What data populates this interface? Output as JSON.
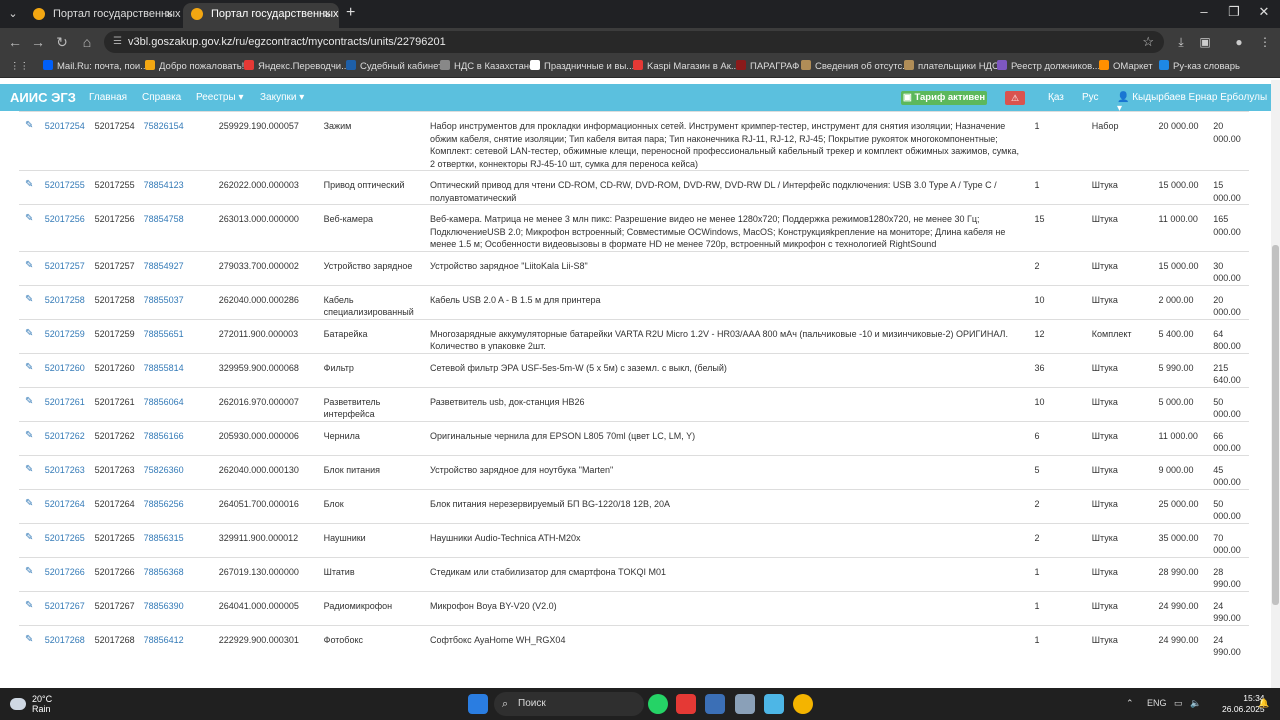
{
  "browser": {
    "tabs": [
      {
        "title": "Портал государственных закуп",
        "active": false
      },
      {
        "title": "Портал государственных закуп",
        "active": true
      }
    ],
    "url": "v3bl.goszakup.gov.kz/ru/egzcontract/mycontracts/units/22796201",
    "bookmarks": [
      {
        "label": "Mail.Ru: почта, пои...",
        "color": "#005ff9"
      },
      {
        "label": "Добро пожаловать!",
        "color": "#f3a712"
      },
      {
        "label": "Яндекс.Переводчи...",
        "color": "#e53935"
      },
      {
        "label": "Судебный кабинет",
        "color": "#1e5fa8"
      },
      {
        "label": "НДС в Казахстане",
        "color": "#888888"
      },
      {
        "label": "Праздничные и вы...",
        "color": "#ffffff"
      },
      {
        "label": "Kaspi Магазин в Ак...",
        "color": "#e53935"
      },
      {
        "label": "ПАРАГРАФ",
        "color": "#8b1a1a"
      },
      {
        "label": "Сведения об отсутс...",
        "color": "#b08d57"
      },
      {
        "label": "плательщики НДС",
        "color": "#b08d57"
      },
      {
        "label": "Реестр должников...",
        "color": "#7e57c2"
      },
      {
        "label": "ОМаркет",
        "color": "#ff8f00"
      },
      {
        "label": "Ру-каз словарь",
        "color": "#1e88e5"
      }
    ]
  },
  "app": {
    "brand": "АИИС ЭГЗ",
    "nav": [
      "Главная",
      "Справка",
      "Реестры ▾",
      "Закупки ▾"
    ],
    "tariff": "Тариф активен",
    "lang_kaz": "Қаз",
    "lang_rus": "Рус",
    "user": "Кыдырбаев Ернар Ерболулы ▾",
    "accent": "#5bc0de"
  },
  "rows": [
    {
      "id": "52017254",
      "num": "52017254",
      "lot": "75826154",
      "code": "259929.190.000057",
      "name": "Зажим",
      "desc": "Набор инструментов для прокладки информационных сетей. Инструмент кримпер-тестер, инструмент для снятия изоляции; Назначение обжим кабеля, снятие изоляции; Тип кабеля витая пара; Тип наконечника RJ-11, RJ-12, RJ-45; Покрытие рукояток многокомпонентные; Комплект: сетевой LAN-тестер, обжимные клещи, переносной профессиональный кабельный трекер и комплект обжимных зажимов, сумка, 2 отвертки, коннекторы RJ-45-10 шт, сумка для переноса кейса)",
      "qty": "1",
      "unit": "Набор",
      "price": "20 000.00",
      "sum": "20 000.00"
    },
    {
      "id": "52017255",
      "num": "52017255",
      "lot": "78854123",
      "code": "262022.000.000003",
      "name": "Привод оптический",
      "desc": "Оптический привод для чтени CD-ROM, CD-RW, DVD-ROM, DVD-RW, DVD-RW DL / Интерфейс подключения: USB 3.0 Type A / Type C / полуавтоматический",
      "qty": "1",
      "unit": "Штука",
      "price": "15 000.00",
      "sum": "15 000.00"
    },
    {
      "id": "52017256",
      "num": "52017256",
      "lot": "78854758",
      "code": "263013.000.000000",
      "name": "Веб-камера",
      "desc": "Веб-камера. Матрица не менее 3 млн пикс: Разрешение видео не менее 1280х720; Поддержка режимов1280х720, не менее 30 Гц; ПодключениеUSB 2.0; Микрофон встроенный; Совместимые OCWindows, MacOS; Конструкцияkрепление на мониторе; Длина кабеля не менее 1.5 м; Особенности видеовызовы в формате HD не менее 720p, встроенный микрофон с технологией RightSound",
      "qty": "15",
      "unit": "Штука",
      "price": "11 000.00",
      "sum": "165 000.00"
    },
    {
      "id": "52017257",
      "num": "52017257",
      "lot": "78854927",
      "code": "279033.700.000002",
      "name": "Устройство зарядное",
      "desc": "Устройство зарядное \"LiitoKala Lii-S8\"",
      "qty": "2",
      "unit": "Штука",
      "price": "15 000.00",
      "sum": "30 000.00"
    },
    {
      "id": "52017258",
      "num": "52017258",
      "lot": "78855037",
      "code": "262040.000.000286",
      "name": "Кабель специализированный",
      "desc": "Кабель USB 2.0 A - B 1.5 м для принтера",
      "qty": "10",
      "unit": "Штука",
      "price": "2 000.00",
      "sum": "20 000.00"
    },
    {
      "id": "52017259",
      "num": "52017259",
      "lot": "78855651",
      "code": "272011.900.000003",
      "name": "Батарейка",
      "desc": "Многозарядные аккумуляторные батарейки VARTA R2U Micro 1.2V - HR03/AAA 800 мАч (пальчиковые -10 и мизинчиковые-2) ОРИГИНАЛ. Количество в упаковке 2шт.",
      "qty": "12",
      "unit": "Комплект",
      "price": "5 400.00",
      "sum": "64 800.00"
    },
    {
      "id": "52017260",
      "num": "52017260",
      "lot": "78855814",
      "code": "329959.900.000068",
      "name": "Фильтр",
      "desc": "Сетевой фильтр ЭРА USF-5es-5m-W (5 х 5м) с заземл. с выкл, (белый)",
      "qty": "36",
      "unit": "Штука",
      "price": "5 990.00",
      "sum": "215 640.00"
    },
    {
      "id": "52017261",
      "num": "52017261",
      "lot": "78856064",
      "code": "262016.970.000007",
      "name": "Разветвитель интерфейса",
      "desc": "Разветвитель usb, док-станция HB26",
      "qty": "10",
      "unit": "Штука",
      "price": "5 000.00",
      "sum": "50 000.00"
    },
    {
      "id": "52017262",
      "num": "52017262",
      "lot": "78856166",
      "code": "205930.000.000006",
      "name": "Чернила",
      "desc": "Оригинальные чернила для EPSON L805 70ml (цвет LC, LM, Y)",
      "qty": "6",
      "unit": "Штука",
      "price": "11 000.00",
      "sum": "66 000.00"
    },
    {
      "id": "52017263",
      "num": "52017263",
      "lot": "75826360",
      "code": "262040.000.000130",
      "name": "Блок питания",
      "desc": "Устройство зарядное для ноутбука \"Marten\"",
      "qty": "5",
      "unit": "Штука",
      "price": "9 000.00",
      "sum": "45 000.00"
    },
    {
      "id": "52017264",
      "num": "52017264",
      "lot": "78856256",
      "code": "264051.700.000016",
      "name": "Блок",
      "desc": "Блок питания нерезервируемый БП BG-1220/18 12В, 20А",
      "qty": "2",
      "unit": "Штука",
      "price": "25 000.00",
      "sum": "50 000.00"
    },
    {
      "id": "52017265",
      "num": "52017265",
      "lot": "78856315",
      "code": "329911.900.000012",
      "name": "Наушники",
      "desc": "Наушники Audio-Technica ATH-M20x",
      "qty": "2",
      "unit": "Штука",
      "price": "35 000.00",
      "sum": "70 000.00"
    },
    {
      "id": "52017266",
      "num": "52017266",
      "lot": "78856368",
      "code": "267019.130.000000",
      "name": "Штатив",
      "desc": "Стедикам или стабилизатор для смартфона TOKQI M01",
      "qty": "1",
      "unit": "Штука",
      "price": "28 990.00",
      "sum": "28 990.00"
    },
    {
      "id": "52017267",
      "num": "52017267",
      "lot": "78856390",
      "code": "264041.000.000005",
      "name": "Радиомикрофон",
      "desc": "Микрофон Boya BY-V20 (V2.0)",
      "qty": "1",
      "unit": "Штука",
      "price": "24 990.00",
      "sum": "24 990.00"
    },
    {
      "id": "52017268",
      "num": "52017268",
      "lot": "78856412",
      "code": "222929.900.000301",
      "name": "Фотобокс",
      "desc": "Софтбокс AyaHome WH_RGX04",
      "qty": "1",
      "unit": "Штука",
      "price": "24 990.00",
      "sum": "24 990.00"
    }
  ],
  "taskbar": {
    "weather_temp": "20°C",
    "weather_desc": "Rain",
    "search": "Поиск",
    "badge": "6",
    "lang": "ENG",
    "time": "15:34",
    "date": "26.06.2025"
  }
}
